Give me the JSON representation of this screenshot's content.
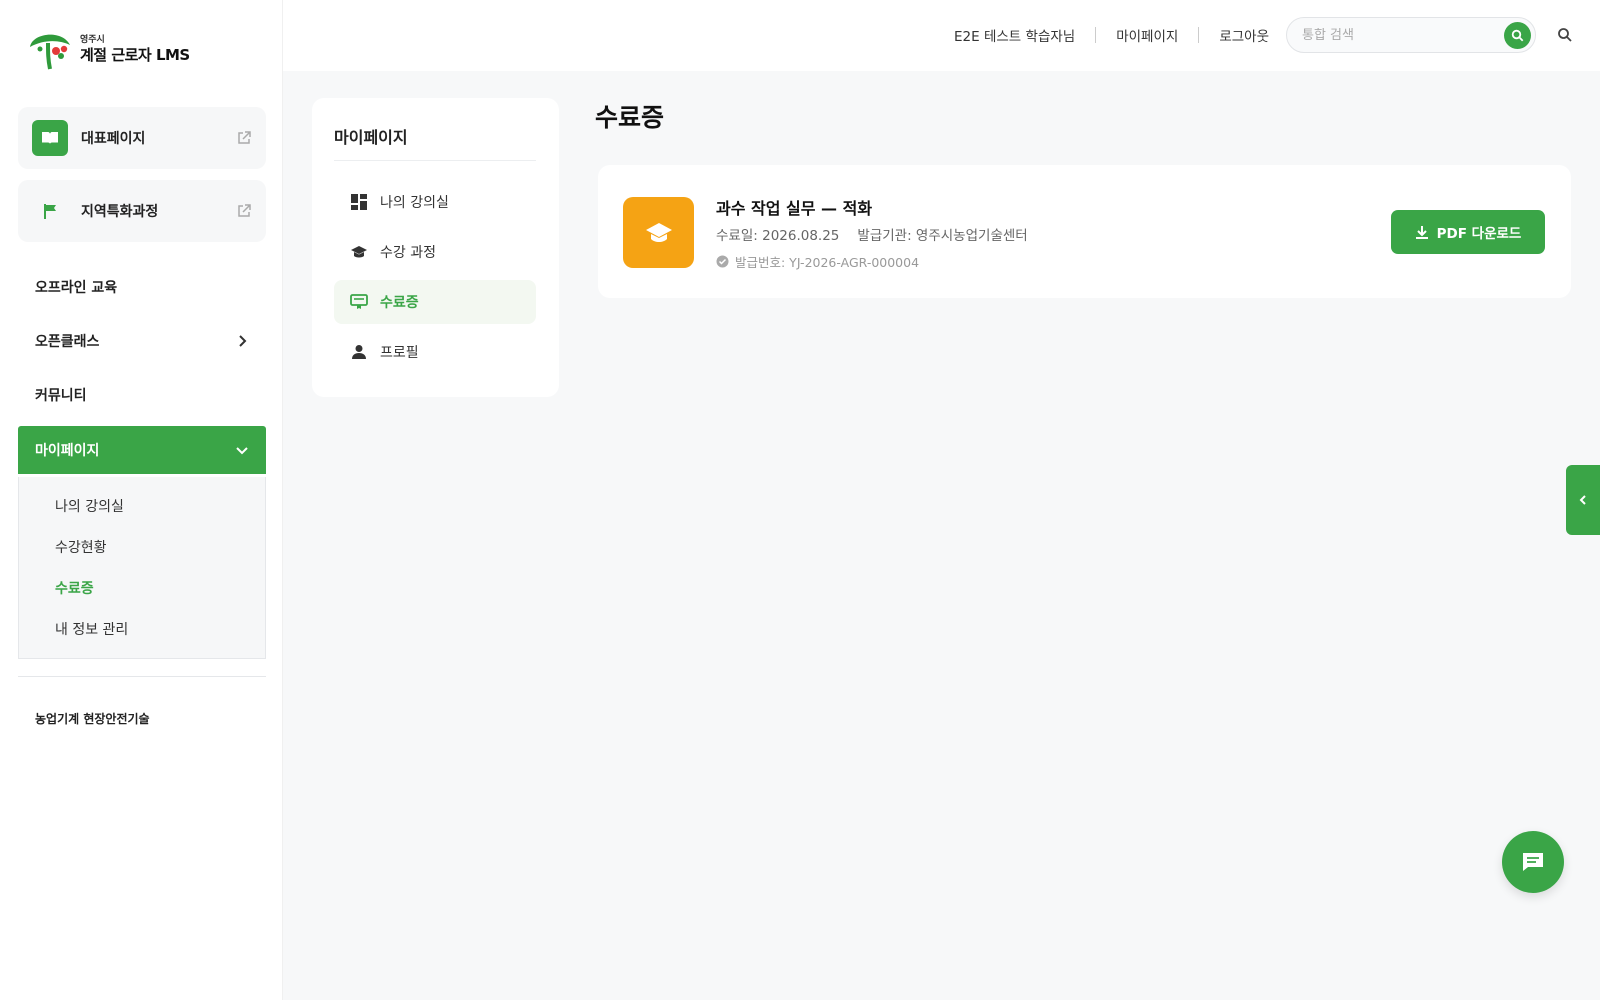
{
  "brand": {
    "city": "영주시",
    "name": "계절 근로자 LMS"
  },
  "sidebar": {
    "quick_links": [
      {
        "label": "대표페이지",
        "icon": "book-icon",
        "color": "#3aa547"
      },
      {
        "label": "지역특화과정",
        "icon": "flag-icon",
        "color": "#3aa547"
      }
    ],
    "nav": [
      {
        "label": "오프라인 교육"
      },
      {
        "label": "오픈클래스"
      },
      {
        "label": "커뮤니티"
      },
      {
        "label": "마이페이지"
      }
    ],
    "submenu": [
      {
        "label": "나의 강의실"
      },
      {
        "label": "수강현황"
      },
      {
        "label": "수료증"
      },
      {
        "label": "내 정보 관리"
      }
    ],
    "footer": "농업기계 현장안전기술"
  },
  "header": {
    "user": "E2E 테스트 학습자님",
    "mypage": "마이페이지",
    "logout": "로그아웃",
    "search_placeholder": "통합 검색"
  },
  "subpanel": {
    "title": "마이페이지",
    "items": [
      {
        "label": "나의 강의실",
        "icon": "dashboard-icon"
      },
      {
        "label": "수강 과정",
        "icon": "graduation-cap-icon"
      },
      {
        "label": "수료증",
        "icon": "certificate-icon"
      },
      {
        "label": "프로필",
        "icon": "person-icon"
      }
    ]
  },
  "main": {
    "title": "수료증",
    "certificate": {
      "course": "과수 작업 실무 — 적화",
      "completed": "수료일: 2026.08.25",
      "issuer": "발급기관: 영주시농업기술센터",
      "number": "발급번호: YJ-2026-AGR-000004",
      "download_label": "PDF 다운로드"
    }
  },
  "colors": {
    "accent": "#3aa547",
    "cert_icon": "#f5a314"
  }
}
